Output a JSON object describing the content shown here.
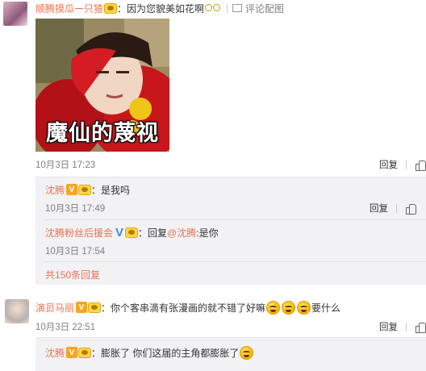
{
  "comment1": {
    "author": "顺腾摸瓜一只猹",
    "separator": "：",
    "text": "因为您貌美如花啊",
    "action_label": "评论配图",
    "meme_caption": "魔仙的蔑视",
    "time": "10月3日 17:23",
    "reply_label": "回复",
    "replies": [
      {
        "author": "沈腾",
        "separator": "：",
        "text": "是我吗",
        "time": "10月3日 17:49",
        "reply_label": "回复"
      },
      {
        "author": "沈腾粉丝后援会",
        "separator": "：",
        "reply_prefix": "回复",
        "mention": "@沈腾",
        "text": ":是你",
        "time": "10月3日 17:54"
      }
    ],
    "more_replies": "共150条回复"
  },
  "comment2": {
    "author": "演员马丽",
    "separator": "：",
    "text": "你个客串滴有张漫画的就不错了好嘛",
    "text_tail": "要什么",
    "time": "10月3日 22:51",
    "reply_label": "回复",
    "reply": {
      "author": "沈腾",
      "separator": "：",
      "text": "膨胀了 你们这届的主角都膨胀了"
    }
  },
  "colors": {
    "link": "#eb7350",
    "muted": "#808080",
    "reply_bg": "#f2f2f5"
  },
  "icons": [
    "vip-badge-icon",
    "laugh-emoji-icon",
    "glasses-icon",
    "like-icon",
    "image-icon",
    "verified-v-icon"
  ]
}
